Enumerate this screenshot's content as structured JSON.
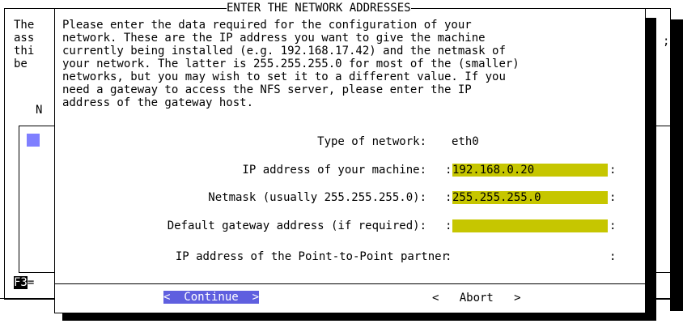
{
  "background": {
    "left_text": "The\nass\nthi\nbe",
    "right_char": ";",
    "n_label": "N",
    "f3_label": "F3",
    "f3_suffix": "="
  },
  "dialog": {
    "title": "ENTER THE NETWORK ADDRESSES",
    "description": "Please enter the data required for the configuration of your\nnetwork. These are the IP address you want to give the machine\ncurrently being installed (e.g. 192.168.17.42) and the netmask of\nyour network. The latter is 255.255.255.0 for most of the (smaller)\nnetworks, but you may wish to set it to a different value. If you\nneed a gateway to access the NFS server, please enter the IP\naddress of the gateway host.",
    "fields": {
      "network_type": {
        "label": "Type of network:",
        "value": "eth0"
      },
      "ip_address": {
        "label": "IP address of your machine:",
        "value": "192.168.0.20"
      },
      "netmask": {
        "label": "Netmask (usually 255.255.255.0):",
        "value": "255.255.255.0"
      },
      "gateway": {
        "label": "Default gateway address (if required):",
        "value": ""
      },
      "ptp_partner": {
        "label": "IP address of the Point-to-Point partner",
        "value": ""
      }
    },
    "colon": ":",
    "buttons": {
      "continue": "<  Continue  >",
      "abort": "<   Abort   >"
    }
  },
  "colors": {
    "entry_bg": "#c6c600",
    "selected_button_bg": "#5f5fdf",
    "list_selection": "#7f7fff"
  }
}
